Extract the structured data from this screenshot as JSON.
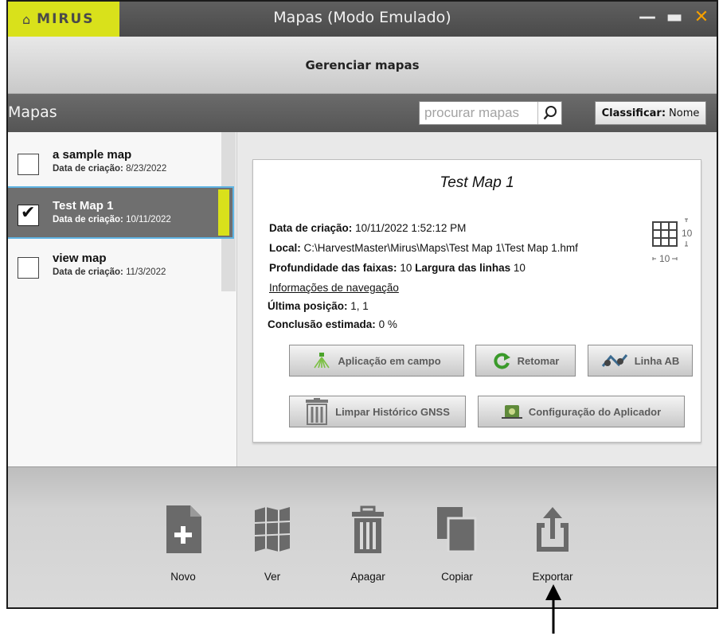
{
  "titlebar": {
    "brand": "MIRUS",
    "title": "Mapas (Modo Emulado)",
    "minimize_glyph": "—",
    "maximize_glyph": "▬",
    "close_glyph": "✕"
  },
  "subheader": {
    "title": "Gerenciar mapas"
  },
  "toolbar": {
    "title": "Mapas",
    "search_placeholder": "procurar mapas",
    "sort_label": "Classificar:",
    "sort_value": "Nome"
  },
  "maps": [
    {
      "name": "a sample map",
      "date_label": "Data de criação:",
      "date": "8/23/2022",
      "checked": false
    },
    {
      "name": "Test Map 1",
      "date_label": "Data de criação:",
      "date": "10/11/2022",
      "checked": true
    },
    {
      "name": "view map",
      "date_label": "Data de criação:",
      "date": "11/3/2022",
      "checked": false
    }
  ],
  "detail": {
    "title": "Test Map 1",
    "created_label": "Data de criação:",
    "created_value": "10/11/2022 1:52:12 PM",
    "location_label": "Local:",
    "location_value": "C:\\HarvestMaster\\Mirus\\Maps\\Test Map 1\\Test Map 1.hmf",
    "depth_label": "Profundidade das faixas:",
    "depth_value": "10",
    "width_label": "Largura das linhas",
    "width_value": "10",
    "nav_link": "Informações de navegação",
    "last_pos_label": "Última posição:",
    "last_pos_value": "1, 1",
    "completion_label": "Conclusão estimada:",
    "completion_value": "0 %",
    "grid_rows": "10",
    "grid_cols": "10"
  },
  "actions": {
    "field_app": "Aplicação em campo",
    "resume": "Retomar",
    "ab_line": "Linha AB",
    "clear_gnss": "Limpar Histórico GNSS",
    "applicator_config": "Configuração do Aplicador"
  },
  "bottom": {
    "new": "Novo",
    "view": "Ver",
    "delete": "Apagar",
    "copy": "Copiar",
    "export": "Exportar"
  },
  "colors": {
    "accent": "#d9e11b",
    "titlebar": "#555555",
    "close": "#f5a000",
    "selection_outline": "#5fb4e3"
  }
}
